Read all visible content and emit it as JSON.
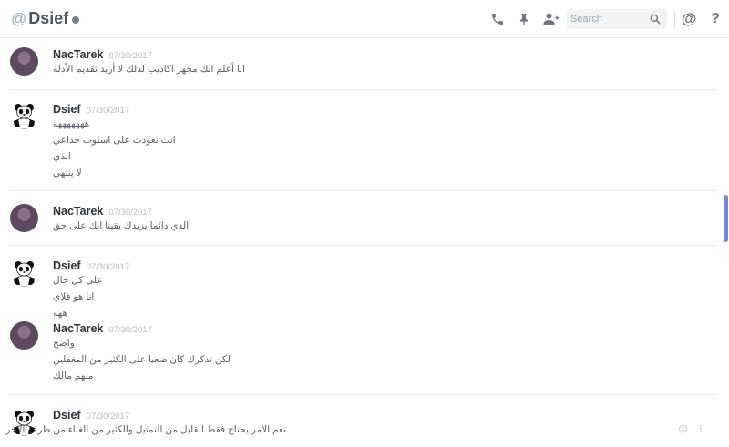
{
  "header": {
    "at_symbol": "@",
    "title": "Dsief",
    "search_placeholder": "Search",
    "icons": [
      "phone-icon",
      "pin-icon",
      "add-friend-icon",
      "search-icon",
      "mention-icon",
      "help-icon"
    ],
    "mention_glyph": "@",
    "help_glyph": "?"
  },
  "messages": [
    {
      "author": "NacTarek",
      "timestamp": "07/30/2017",
      "lines": [
        "انا أعلم انك مجهز اكاذيب لذلك لا أريد تقديم الأدلة"
      ]
    },
    {
      "author": "Dsief",
      "timestamp": "07/30/2017",
      "lines": [
        "هههههههه",
        "انت تعودت على اسلوب خداعي",
        "الذي",
        "لا ينتهي"
      ]
    },
    {
      "author": "NacTarek",
      "timestamp": "07/30/2017",
      "lines": [
        "الذي دائما يزيدك يقينا انك على حق"
      ]
    },
    {
      "author": "Dsief",
      "timestamp": "07/30/2017",
      "lines": [
        "على كل حال",
        "انا هو فلاي",
        "ههه"
      ]
    },
    {
      "author": "NacTarek",
      "timestamp": "07/30/2017",
      "lines": [
        "واضح",
        "لكن تذكرك كان صعبا على الكثير من المغفلين",
        "منهم مالك"
      ]
    },
    {
      "author": "Dsief",
      "timestamp": "07/30/2017",
      "lines": [
        "نعم الامر يحتاج فقط القليل من التمثيل والكثير من الغباء من طرف الاخر"
      ]
    }
  ],
  "colors": {
    "accent": "#7289da",
    "username": "#2e3338",
    "timestamp": "#b9bbbe",
    "status_offline": "#747f8d"
  }
}
